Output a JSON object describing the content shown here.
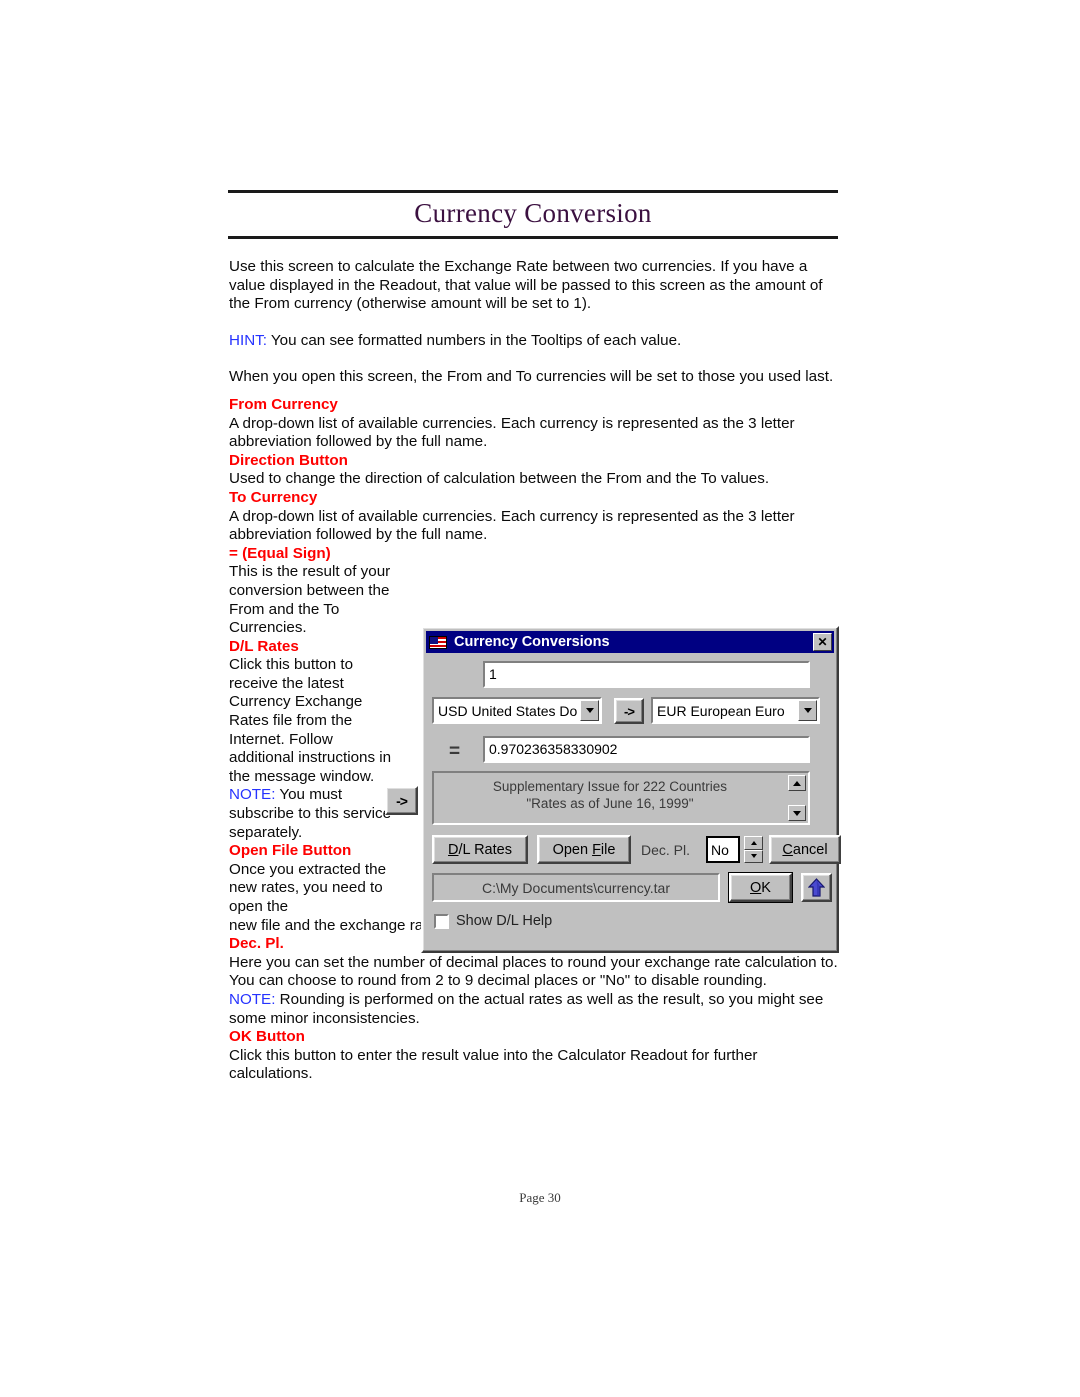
{
  "document": {
    "title": "Currency Conversion",
    "footer": "Page 30"
  },
  "body": {
    "intro": "Use this screen to calculate the Exchange Rate between two currencies.  If you have a value displayed in the Readout, that value will be passed to this screen as the amount of the From currency (otherwise amount will be set to 1).",
    "hint_label": "HINT:",
    "hint_text": " You can see formatted numbers in the Tooltips of each value.",
    "open_note": "When you open this screen, the From and To currencies will be set to those you used last."
  },
  "terms": {
    "from_currency": {
      "heading": "From Currency",
      "text": "A drop-down list of available currencies.  Each currency is represented as the 3 letter abbreviation followed by the full name."
    },
    "direction_button": {
      "heading": "Direction Button",
      "text": "Used to change the direction of calculation between the From and the To values."
    },
    "to_currency": {
      "heading": "To Currency",
      "text": "A drop-down list of available currencies.  Each currency is represented as the 3 letter abbreviation followed by the full name."
    },
    "equal_sign": {
      "heading": "= (Equal Sign)",
      "text": "This is the result of your conversion between the From and the To Currencies."
    },
    "dl_rates": {
      "heading": "D/L Rates",
      "text": "Click this button to receive the latest Currency Exchange Rates file from the Internet.  Follow additional instructions in the message window.",
      "note_label": "NOTE:",
      "note_text": " You must subscribe to this service separately."
    },
    "open_file_button": {
      "heading": "Open File Button",
      "text_part1": "Once you extracted the new rates, you need to open the",
      "text_part2": "new file and the exchange rates (plus the To and From Currencies) will be refreshed."
    },
    "dec_pl": {
      "heading": "Dec. Pl.",
      "text": "Here you can set the number of decimal places to round your exchange rate calculation to.  You can choose to round from 2 to 9 decimal places or \"No\" to disable rounding.",
      "note_label": "NOTE:",
      "note_text": " Rounding is performed on the actual rates as well as the result, so you might see some minor inconsistencies."
    },
    "ok_button": {
      "heading": "OK Button",
      "text": "Click this button to enter the result value into the Calculator Readout for further calculations."
    }
  },
  "floating_direction_button": {
    "label": "->"
  },
  "dialog": {
    "title": "Currency Conversions",
    "close_label": "✕",
    "amount_value": "1",
    "from_currency_value": "USD  United States Do",
    "direction_button_label": "->",
    "to_currency_value": "EUR  European Euro",
    "equals_label": "=",
    "result_value": "0.970236358330902",
    "message_line1": "Supplementary Issue for 222 Countries",
    "message_line2": "\"Rates as of June 16, 1999\"",
    "dl_rates_label": "D/L Rates",
    "dl_rates_acc": "D",
    "dl_rates_rest": "/L Rates",
    "open_file_pre": "Open ",
    "open_file_acc": "F",
    "open_file_rest": "ile",
    "dec_pl_label": "Dec. Pl.",
    "dec_pl_value": "No",
    "cancel_acc": "C",
    "cancel_rest": "ancel",
    "file_path": "C:\\My Documents\\currency.tar",
    "ok_acc": "O",
    "ok_rest": "K",
    "show_dl_help_label": "Show D/L Help",
    "show_dl_help_checked": false
  },
  "colors": {
    "heading_red": "#fe0000",
    "note_blue": "#2633ff",
    "title_purple": "#3b1040",
    "titlebar_blue": "#000082",
    "dialog_face": "#c0c0c0"
  }
}
